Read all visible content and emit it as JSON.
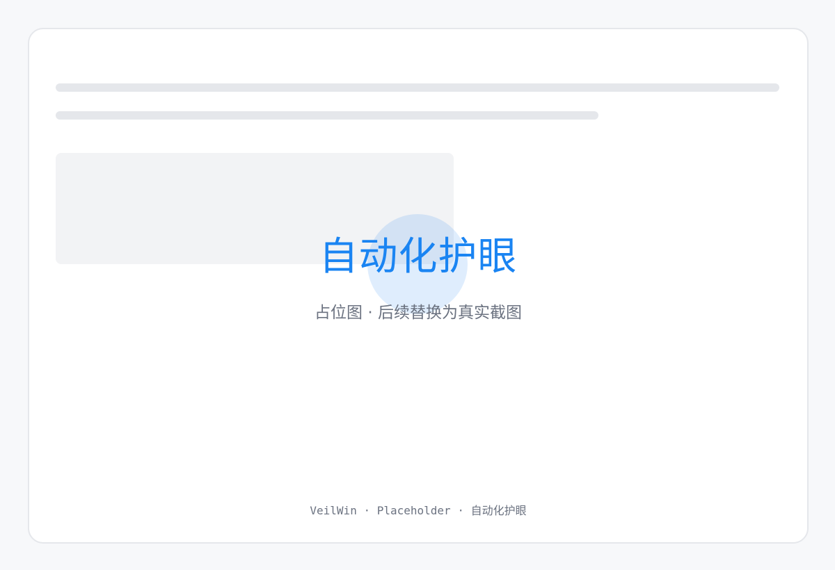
{
  "placeholder": {
    "headline": "自动化护眼",
    "subtitle": "占位图 · 后续替换为真实截图",
    "footer": "VeilWin · Placeholder · 自动化护眼"
  },
  "colors": {
    "accent": "#1a84f2",
    "muted_text": "#6b7280",
    "skeleton": "#e5e7eb",
    "background": "#f7f8fa"
  }
}
